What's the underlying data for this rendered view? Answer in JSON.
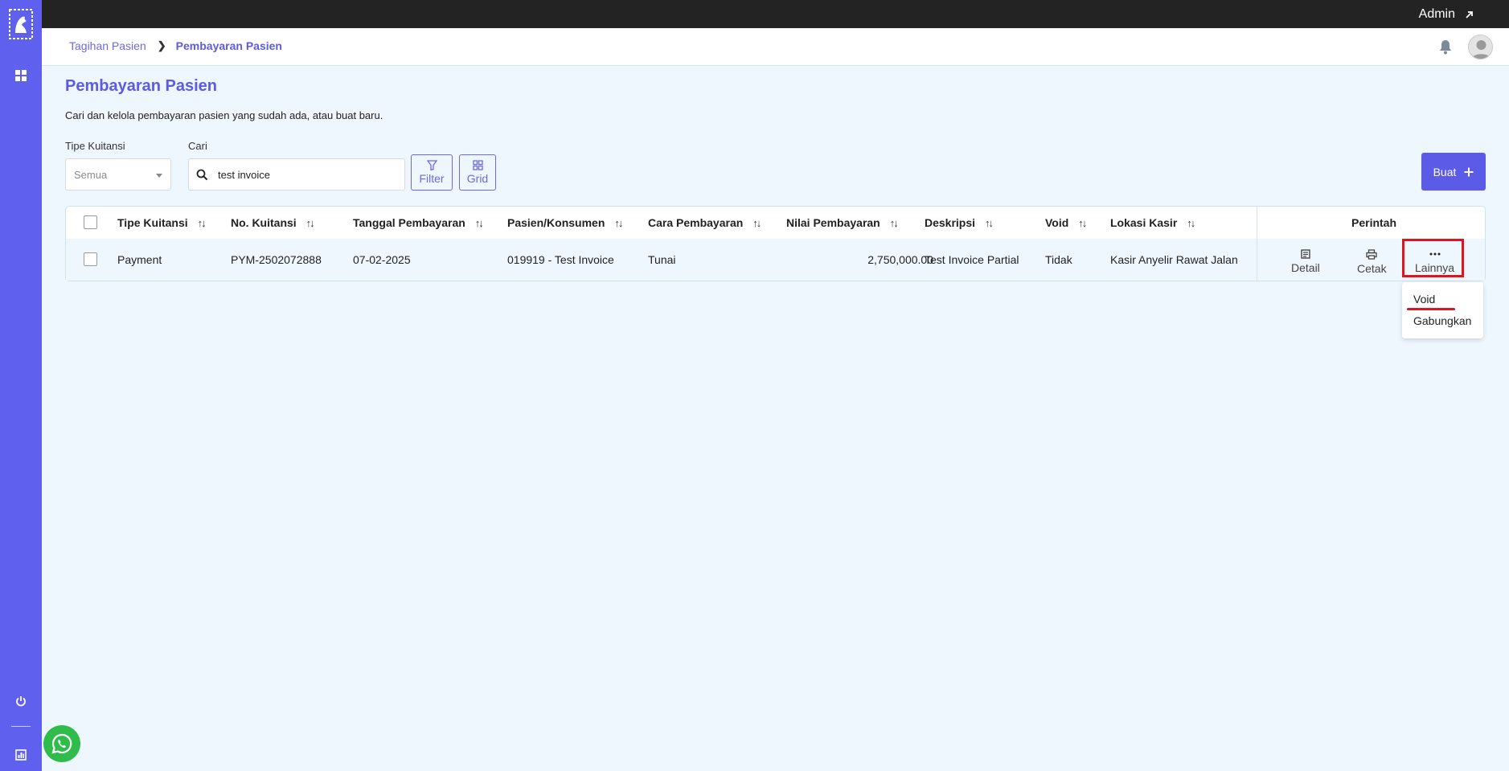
{
  "topbar": {
    "user_label": "Admin"
  },
  "breadcrumb": {
    "parent": "Tagihan Pasien",
    "current": "Pembayaran Pasien"
  },
  "page": {
    "title": "Pembayaran Pasien",
    "description": "Cari dan kelola pembayaran pasien yang sudah ada, atau buat baru."
  },
  "filters": {
    "type_label": "Tipe Kuitansi",
    "type_value": "Semua",
    "search_label": "Cari",
    "search_value": "test invoice",
    "filter_button": "Filter",
    "grid_button": "Grid",
    "create_button": "Buat"
  },
  "table": {
    "headers": {
      "tipe": "Tipe Kuitansi",
      "no": "No. Kuitansi",
      "tanggal": "Tanggal Pembayaran",
      "pasien": "Pasien/Konsumen",
      "cara": "Cara Pembayaran",
      "nilai": "Nilai Pembayaran",
      "deskripsi": "Deskripsi",
      "void": "Void",
      "lokasi": "Lokasi Kasir",
      "perintah": "Perintah"
    },
    "rows": [
      {
        "tipe": "Payment",
        "no": "PYM-2502072888",
        "tanggal": "07-02-2025",
        "pasien": "019919 - Test Invoice",
        "cara": "Tunai",
        "nilai": "2,750,000.00",
        "deskripsi": "Test Invoice Partial",
        "void": "Tidak",
        "lokasi": "Kasir Anyelir Rawat Jalan"
      }
    ],
    "actions": {
      "detail": "Detail",
      "cetak": "Cetak",
      "lainnya": "Lainnya"
    }
  },
  "dropdown": {
    "items": [
      "Void",
      "Gabungkan"
    ]
  },
  "icons": {
    "sidebar": [
      "app-logo",
      "dashboard-grid-icon",
      "power-icon",
      "report-icon"
    ],
    "whatsapp": "whatsapp-icon"
  },
  "colors": {
    "sidebar": "#6060ef",
    "accent": "#5b5be8",
    "topbar": "#232323",
    "background": "#eef6fe",
    "highlight": "#e0141e",
    "whatsapp": "#2fbc4a"
  }
}
